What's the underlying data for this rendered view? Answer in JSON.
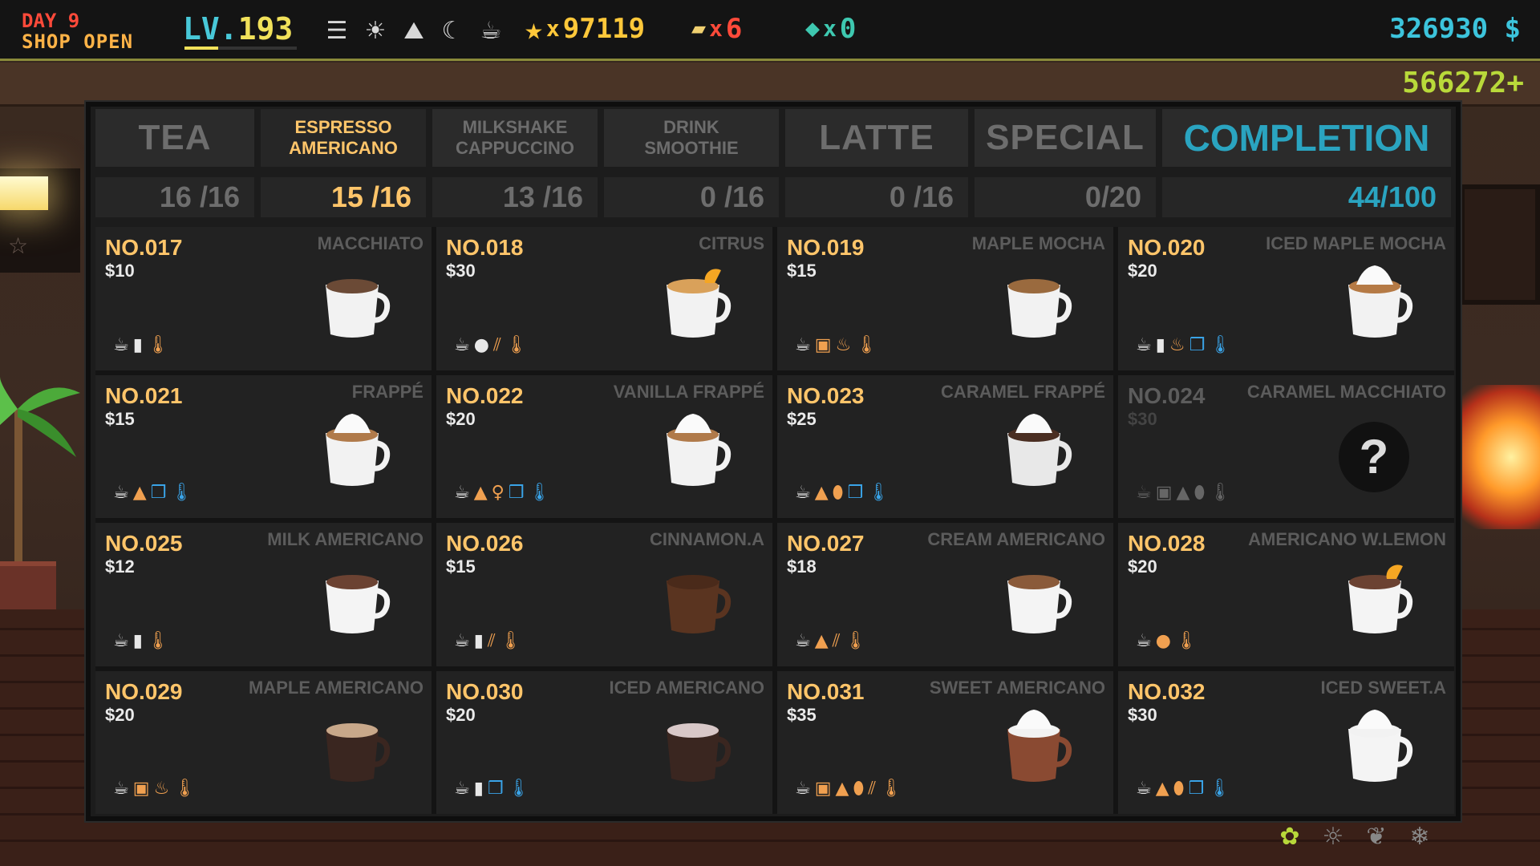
{
  "hud": {
    "day": "DAY 9",
    "shop_status": "SHOP OPEN",
    "level_prefix": "LV.",
    "level": "193",
    "stars": "97119",
    "tickets": "6",
    "gems": "0",
    "money": "326930 $",
    "income": "566272+"
  },
  "tabs": [
    {
      "label": "TEA",
      "count": "16 /16"
    },
    {
      "label": "ESPRESSO\nAMERICANO",
      "count": "15 /16"
    },
    {
      "label": "MILKSHAKE\nCAPPUCCINO",
      "count": "13 /16"
    },
    {
      "label": "DRINK\nSMOOTHIE",
      "count": "0 /16"
    },
    {
      "label": "LATTE",
      "count": "0 /16"
    },
    {
      "label": "SPECIAL",
      "count": "0/20"
    },
    {
      "label": "COMPLETION",
      "count": "44/100"
    }
  ],
  "recipes": [
    {
      "no": "NO.017",
      "price": "$10",
      "name": "MACCHIATO",
      "cup": "white-cup",
      "ing": [
        "cup",
        "milk",
        "hot"
      ]
    },
    {
      "no": "NO.018",
      "price": "$30",
      "name": "CITRUS",
      "cup": "citrus-cup",
      "ing": [
        "cup",
        "nut",
        "cinnamon",
        "hot"
      ]
    },
    {
      "no": "NO.019",
      "price": "$15",
      "name": "MAPLE MOCHA",
      "cup": "tall-mug",
      "ing": [
        "cup",
        "grinder",
        "maple",
        "hot"
      ]
    },
    {
      "no": "NO.020",
      "price": "$20",
      "name": "ICED MAPLE MOCHA",
      "cup": "tall-mug-cream",
      "ing": [
        "cup",
        "milk",
        "maple",
        "ice",
        "cold"
      ]
    },
    {
      "no": "NO.021",
      "price": "$15",
      "name": "FRAPPÉ",
      "cup": "frappe",
      "ing": [
        "cup",
        "sugar",
        "ice",
        "cold"
      ]
    },
    {
      "no": "NO.022",
      "price": "$20",
      "name": "VANILLA FRAPPÉ",
      "cup": "frappe",
      "ing": [
        "cup",
        "sugar",
        "vanilla",
        "ice",
        "cold"
      ]
    },
    {
      "no": "NO.023",
      "price": "$25",
      "name": "CARAMEL FRAPPÉ",
      "cup": "frappe-dark",
      "ing": [
        "cup",
        "sugar",
        "caramel",
        "ice",
        "cold"
      ]
    },
    {
      "no": "NO.024",
      "price": "$30",
      "name": "CARAMEL MACCHIATO",
      "cup": "unknown",
      "locked": true,
      "ing": [
        "cup",
        "grinder",
        "sugar",
        "caramel",
        "hot"
      ]
    },
    {
      "no": "NO.025",
      "price": "$12",
      "name": "MILK AMERICANO",
      "cup": "white-mug",
      "ing": [
        "cup",
        "milk",
        "hot"
      ]
    },
    {
      "no": "NO.026",
      "price": "$15",
      "name": "CINNAMON.A",
      "cup": "brown-mug",
      "ing": [
        "cup",
        "milk",
        "cinnamon",
        "hot"
      ]
    },
    {
      "no": "NO.027",
      "price": "$18",
      "name": "CREAM AMERICANO",
      "cup": "white-mug-heart",
      "ing": [
        "cup",
        "sugar",
        "cinnamon",
        "hot"
      ]
    },
    {
      "no": "NO.028",
      "price": "$20",
      "name": "AMERICANO W.LEMON",
      "cup": "white-mug-lemon",
      "ing": [
        "cup",
        "lemon",
        "hot"
      ]
    },
    {
      "no": "NO.029",
      "price": "$20",
      "name": "MAPLE AMERICANO",
      "cup": "dark-mug",
      "ing": [
        "cup",
        "grinder",
        "maple",
        "hot"
      ]
    },
    {
      "no": "NO.030",
      "price": "$20",
      "name": "ICED AMERICANO",
      "cup": "dark-mug-ice",
      "ing": [
        "cup",
        "milk",
        "ice",
        "cold"
      ]
    },
    {
      "no": "NO.031",
      "price": "$35",
      "name": "SWEET AMERICANO",
      "cup": "brown-mug-cream",
      "ing": [
        "cup",
        "grinder",
        "sugar",
        "caramel",
        "cinnamon",
        "hot"
      ]
    },
    {
      "no": "NO.032",
      "price": "$30",
      "name": "ICED SWEET.A",
      "cup": "white-mug-cream",
      "ing": [
        "cup",
        "sugar",
        "caramel",
        "ice",
        "cold"
      ]
    }
  ]
}
